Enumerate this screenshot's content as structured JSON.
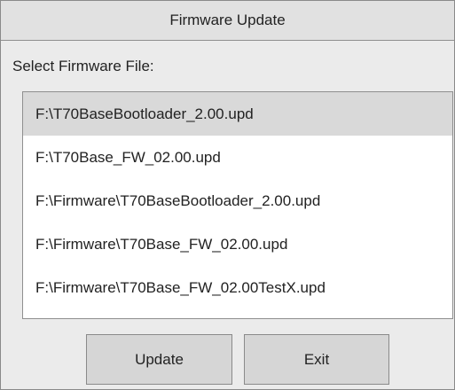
{
  "window": {
    "title": "Firmware Update"
  },
  "prompt": "Select Firmware File:",
  "file_list": {
    "selected_index": 0,
    "items": [
      "F:\\T70BaseBootloader_2.00.upd",
      "F:\\T70Base_FW_02.00.upd",
      "F:\\Firmware\\T70BaseBootloader_2.00.upd",
      "F:\\Firmware\\T70Base_FW_02.00.upd",
      "F:\\Firmware\\T70Base_FW_02.00TestX.upd"
    ]
  },
  "buttons": {
    "update_label": "Update",
    "exit_label": "Exit"
  }
}
